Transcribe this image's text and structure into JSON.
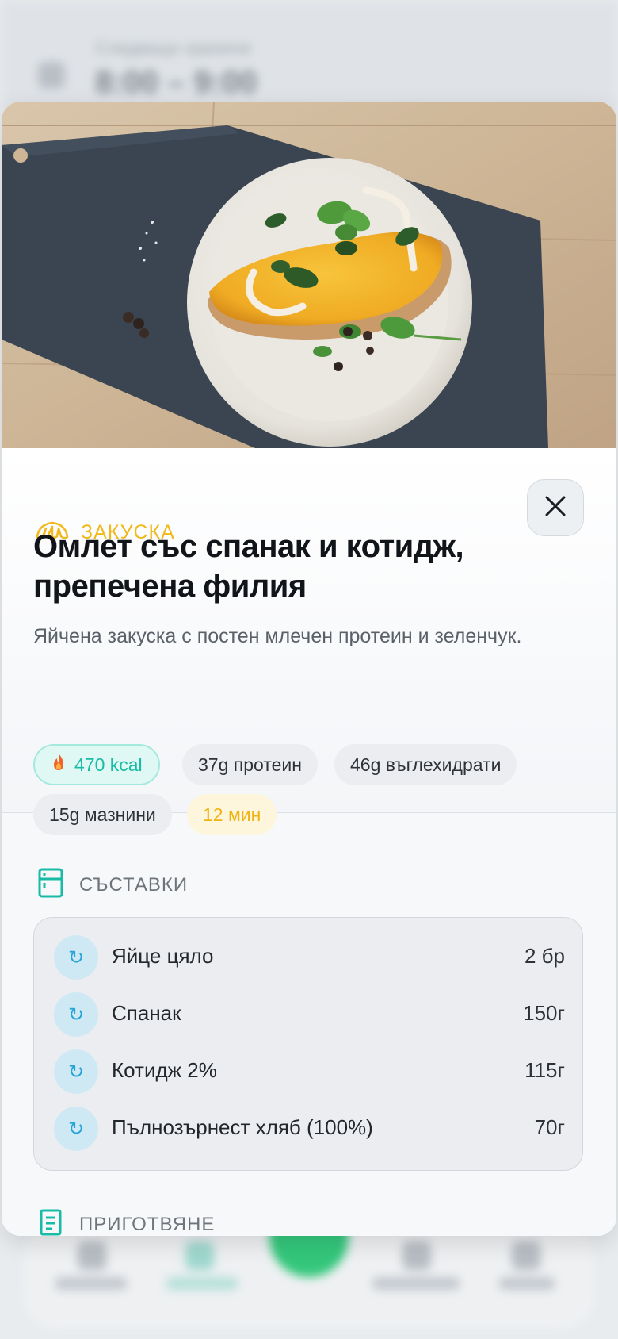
{
  "background": {
    "header_small": "Следващо хранене",
    "header_big": "8:00 – 9:00"
  },
  "meal": {
    "type_label": "ЗАКУСКА",
    "title": "Омлет със спанак и котидж, препечена филия",
    "subtitle": "Яйчена закуска с постен млечен протеин и зеленчук."
  },
  "nutrition": {
    "kcal": "470 kcal",
    "protein": "37g протеин",
    "carbs": "46g въглехидрати",
    "fat": "15g мазнини",
    "time": "12 мин"
  },
  "ingredients": {
    "heading": "СЪСТАВКИ",
    "items": [
      {
        "name": "Яйце цяло",
        "qty": "2 бр",
        "icon": "swap-icon"
      },
      {
        "name": "Спанак",
        "qty": "150г",
        "icon": "swap-icon"
      },
      {
        "name": "Котидж 2%",
        "qty": "115г",
        "icon": "swap-icon"
      },
      {
        "name": "Пълнозърнест хляб (100%)",
        "qty": "70г",
        "icon": "swap-icon"
      }
    ]
  },
  "preparation": {
    "heading": "ПРИГОТВЯНЕ"
  },
  "colors": {
    "accent_teal": "#17bba6",
    "accent_yellow": "#f2b91c",
    "swap_blue": "#25a4d8"
  }
}
